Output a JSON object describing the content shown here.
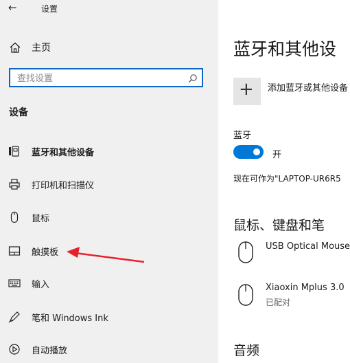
{
  "window": {
    "title": "设置",
    "back_icon": "back-arrow-icon"
  },
  "sidebar": {
    "home": {
      "label": "主页",
      "icon": "home-icon"
    },
    "search": {
      "placeholder": "查找设置",
      "icon": "search-icon"
    },
    "section_title": "设备",
    "items": [
      {
        "label": "蓝牙和其他设备",
        "icon": "bluetooth-devices-icon"
      },
      {
        "label": "打印机和扫描仪",
        "icon": "printer-icon"
      },
      {
        "label": "鼠标",
        "icon": "mouse-icon"
      },
      {
        "label": "触摸板",
        "icon": "touchpad-icon"
      },
      {
        "label": "输入",
        "icon": "keyboard-icon"
      },
      {
        "label": "笔和 Windows Ink",
        "icon": "pen-icon"
      },
      {
        "label": "自动播放",
        "icon": "autoplay-icon"
      }
    ]
  },
  "main": {
    "title": "蓝牙和其他设",
    "add_device": {
      "label": "添加蓝牙或其他设备",
      "icon": "plus-icon"
    },
    "bluetooth": {
      "label": "蓝牙",
      "toggle_state": "开",
      "on": true
    },
    "discoverable_text": "现在可作为\"LAPTOP-UR6R5",
    "mouse_section": {
      "title": "鼠标、键盘和笔",
      "devices": [
        {
          "name": "USB Optical Mouse",
          "status": "",
          "icon": "mouse-icon"
        },
        {
          "name": "Xiaoxin Mplus 3.0",
          "status": "已配对",
          "icon": "mouse-icon"
        }
      ]
    },
    "audio_section": {
      "title": "音频"
    }
  },
  "colors": {
    "accent": "#0078d7",
    "sidebar_bg": "#f0f0f0",
    "arrow": "#e8202a"
  }
}
